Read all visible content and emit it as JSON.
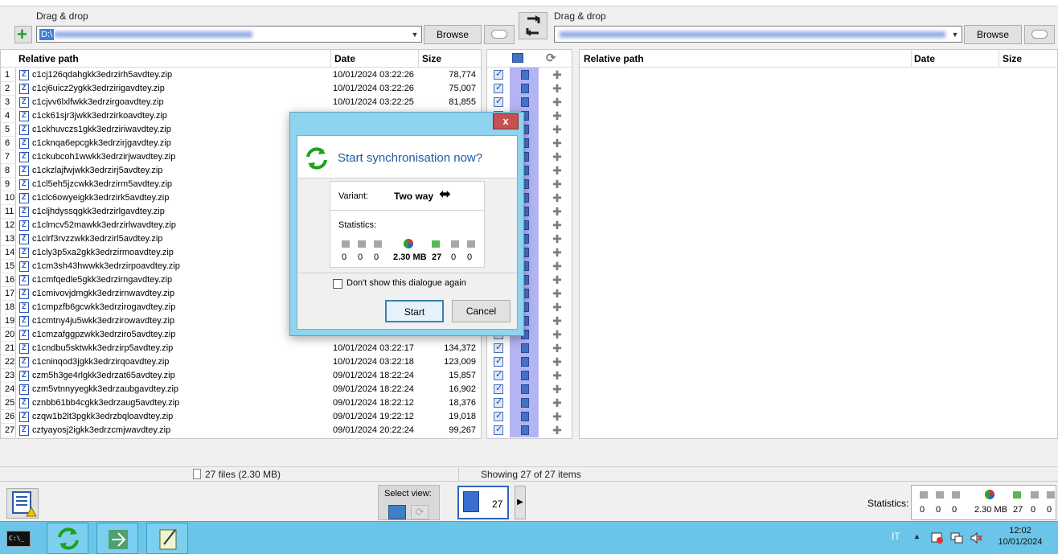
{
  "left_panel": {
    "drag_label": "Drag & drop",
    "path_prefix": "D:\\",
    "browse_label": "Browse",
    "headers": {
      "path": "Relative path",
      "date": "Date",
      "size": "Size"
    },
    "rows": [
      {
        "n": "1",
        "name": "c1cj126qdahgkk3edrzirh5avdtey.zip",
        "date": "10/01/2024  03:22:26",
        "size": "78,774"
      },
      {
        "n": "2",
        "name": "c1cj6uicz2ygkk3edrzirigavdtey.zip",
        "date": "10/01/2024  03:22:26",
        "size": "75,007"
      },
      {
        "n": "3",
        "name": "c1cjvv6lxlfwkk3edrzirgoavdtey.zip",
        "date": "10/01/2024  03:22:25",
        "size": "81,855"
      },
      {
        "n": "4",
        "name": "c1ck61sjr3jwkk3edrzirkoavdtey.zip",
        "date": "",
        "size": ""
      },
      {
        "n": "5",
        "name": "c1ckhuvczs1gkk3edrziriwavdtey.zip",
        "date": "",
        "size": ""
      },
      {
        "n": "6",
        "name": "c1cknqa6epcgkk3edrzirjgavdtey.zip",
        "date": "",
        "size": ""
      },
      {
        "n": "7",
        "name": "c1ckubcoh1wwkk3edrzirjwavdtey.zip",
        "date": "",
        "size": ""
      },
      {
        "n": "8",
        "name": "c1ckzlajfwjwkk3edrzirj5avdtey.zip",
        "date": "",
        "size": ""
      },
      {
        "n": "9",
        "name": "c1cl5eh5jzcwkk3edrzirm5avdtey.zip",
        "date": "",
        "size": ""
      },
      {
        "n": "10",
        "name": "c1clc6owyeigkk3edrzirk5avdtey.zip",
        "date": "",
        "size": ""
      },
      {
        "n": "11",
        "name": "c1cljhdyssqgkk3edrzirlgavdtey.zip",
        "date": "",
        "size": ""
      },
      {
        "n": "12",
        "name": "c1clmcv52mawkk3edrzirlwavdtey.zip",
        "date": "",
        "size": ""
      },
      {
        "n": "13",
        "name": "c1clrf3rvzzwkk3edrzirl5avdtey.zip",
        "date": "",
        "size": ""
      },
      {
        "n": "14",
        "name": "c1cly3p5xa2gkk3edrzirmoavdtey.zip",
        "date": "",
        "size": ""
      },
      {
        "n": "15",
        "name": "c1cm3sh43hwwkk3edrzirpoavdtey.zip",
        "date": "",
        "size": ""
      },
      {
        "n": "16",
        "name": "c1cmfqedle5gkk3edrzirngavdtey.zip",
        "date": "",
        "size": ""
      },
      {
        "n": "17",
        "name": "c1cmivovjdmgkk3edrzirnwavdtey.zip",
        "date": "",
        "size": ""
      },
      {
        "n": "18",
        "name": "c1cmpzfb6gcwkk3edrzirogavdtey.zip",
        "date": "",
        "size": ""
      },
      {
        "n": "19",
        "name": "c1cmtny4ju5wkk3edrzirowavdtey.zip",
        "date": "",
        "size": ""
      },
      {
        "n": "20",
        "name": "c1cmzafggpzwkk3edrziro5avdtey.zip",
        "date": "",
        "size": ""
      },
      {
        "n": "21",
        "name": "c1cndbu5sktwkk3edrzirp5avdtey.zip",
        "date": "10/01/2024  03:22:17",
        "size": "134,372"
      },
      {
        "n": "22",
        "name": "c1cninqod3jgkk3edrzirqoavdtey.zip",
        "date": "10/01/2024  03:22:18",
        "size": "123,009"
      },
      {
        "n": "23",
        "name": "czm5h3ge4rlgkk3edrzat65avdtey.zip",
        "date": "09/01/2024  18:22:24",
        "size": "15,857"
      },
      {
        "n": "24",
        "name": "czm5vtnnyyegkk3edrzaubgavdtey.zip",
        "date": "09/01/2024  18:22:24",
        "size": "16,902"
      },
      {
        "n": "25",
        "name": "cznbb61bb4cgkk3edrzaug5avdtey.zip",
        "date": "09/01/2024  18:22:12",
        "size": "18,376"
      },
      {
        "n": "26",
        "name": "czqw1b2lt3pgkk3edrzbqloavdtey.zip",
        "date": "09/01/2024  19:22:12",
        "size": "19,018"
      },
      {
        "n": "27",
        "name": "cztyayosj2igkk3edrzcmjwavdtey.zip",
        "date": "09/01/2024  20:22:24",
        "size": "99,267"
      }
    ]
  },
  "right_panel": {
    "drag_label": "Drag & drop",
    "browse_label": "Browse",
    "headers": {
      "path": "Relative path",
      "date": "Date",
      "size": "Size"
    }
  },
  "status": {
    "left": "27 files  (2.30 MB)",
    "center": "Showing 27 of 27 items"
  },
  "bottom": {
    "select_view_label": "Select view:",
    "overview_count": "27",
    "statistics_label": "Statistics:",
    "stats": [
      "0",
      "0",
      "0",
      "2.30 MB",
      "27",
      "0",
      "0"
    ]
  },
  "dialog": {
    "close_label": "x",
    "title": "Start synchronisation now?",
    "variant_label": "Variant:",
    "variant_value": "Two way",
    "variant_glyph": "⬌",
    "statistics_label": "Statistics:",
    "stats": [
      "0",
      "0",
      "0",
      "2.30 MB",
      "27",
      "0",
      "0"
    ],
    "checkbox_label": "Don't show this dialogue again",
    "start_label": "Start",
    "cancel_label": "Cancel"
  },
  "taskbar": {
    "language": "IT",
    "tray_arrow": "▲",
    "time": "12:02",
    "date": "10/01/2024",
    "cmd_label": "C:\\_"
  },
  "colors": {
    "taskbar": "#6ac5e8",
    "dialog_frame": "#8fd4ee",
    "title_blue": "#1e5aa8",
    "select_band": "#b4b4f4",
    "close_red": "#c75050"
  }
}
